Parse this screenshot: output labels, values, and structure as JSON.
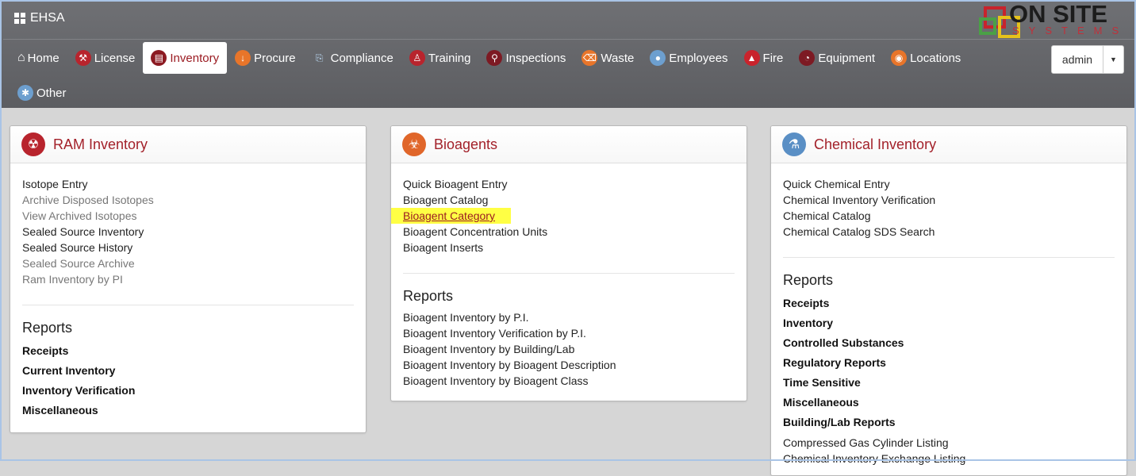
{
  "app": {
    "title": "EHSA"
  },
  "logo": {
    "text_main": "ON SITE",
    "text_sub": "SYSTEMS"
  },
  "nav": {
    "items": [
      {
        "label": "Home",
        "icon": "home-icon"
      },
      {
        "label": "License",
        "icon": "wrench-icon"
      },
      {
        "label": "Inventory",
        "icon": "inventory-icon"
      },
      {
        "label": "Procure",
        "icon": "download-arrow-icon"
      },
      {
        "label": "Compliance",
        "icon": "clipboard-icon"
      },
      {
        "label": "Training",
        "icon": "trainer-icon"
      },
      {
        "label": "Inspections",
        "icon": "magnifier-icon"
      },
      {
        "label": "Waste",
        "icon": "trash-icon"
      },
      {
        "label": "Employees",
        "icon": "people-icon"
      },
      {
        "label": "Fire",
        "icon": "flame-icon"
      },
      {
        "label": "Equipment",
        "icon": "gauge-icon"
      },
      {
        "label": "Locations",
        "icon": "map-pin-icon"
      },
      {
        "label": "Other",
        "icon": "asterisk-icon"
      }
    ],
    "active": "Inventory"
  },
  "user": {
    "name": "admin"
  },
  "colors": {
    "accent": "#a3212a",
    "highlight": "#ffff44",
    "topbar": "#65666a"
  },
  "panels": {
    "ram": {
      "title": "RAM Inventory",
      "links": [
        "Isotope Entry",
        "Archive Disposed Isotopes",
        "View Archived Isotopes",
        "Sealed Source Inventory",
        "Sealed Source History",
        "Sealed Source Archive",
        "Ram Inventory by PI"
      ],
      "reports_title": "Reports",
      "reports": [
        "Receipts",
        "Current Inventory",
        "Inventory Verification",
        "Miscellaneous"
      ]
    },
    "bio": {
      "title": "Bioagents",
      "links": [
        "Quick Bioagent Entry",
        "Bioagent Catalog",
        "Bioagent Category",
        "Bioagent Concentration Units",
        "Bioagent Inserts"
      ],
      "reports_title": "Reports",
      "reports": [
        "Bioagent Inventory by P.I.",
        "Bioagent Inventory Verification by P.I.",
        "Bioagent Inventory by Building/Lab",
        "Bioagent Inventory by Bioagent Description",
        "Bioagent Inventory by Bioagent Class"
      ]
    },
    "chem": {
      "title": "Chemical Inventory",
      "links": [
        "Quick Chemical Entry",
        "Chemical Inventory Verification",
        "Chemical Catalog",
        "Chemical Catalog SDS Search"
      ],
      "reports_title": "Reports",
      "reports": [
        "Receipts",
        "Inventory",
        "Controlled Substances",
        "Regulatory Reports",
        "Time Sensitive",
        "Miscellaneous",
        "Building/Lab Reports"
      ],
      "extra_links": [
        "Compressed Gas Cylinder Listing",
        "Chemical Inventory Exchange Listing"
      ]
    }
  }
}
